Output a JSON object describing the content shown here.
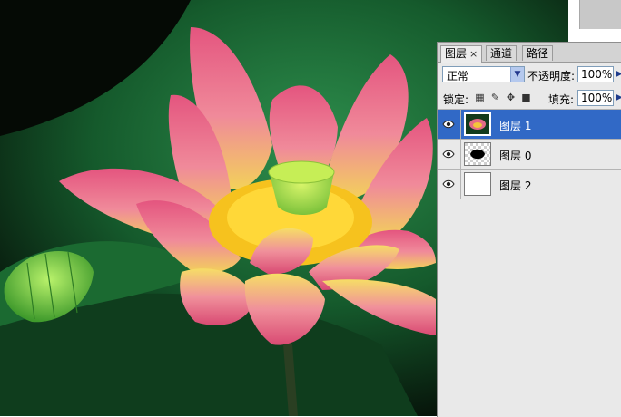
{
  "tabs": [
    {
      "label": "图层",
      "close": "×",
      "active": true
    },
    {
      "label": "通道",
      "active": false
    },
    {
      "label": "路径",
      "active": false
    }
  ],
  "blend_mode": {
    "value": "正常"
  },
  "opacity": {
    "label": "不透明度:",
    "value": "100%"
  },
  "lock": {
    "label": "锁定:"
  },
  "fill": {
    "label": "填充:",
    "value": "100%"
  },
  "layers": [
    {
      "name": "图层 1",
      "selected": true,
      "visible": true,
      "thumb": "lotus-photo"
    },
    {
      "name": "图层 0",
      "selected": false,
      "visible": true,
      "thumb": "mask-shape"
    },
    {
      "name": "图层 2",
      "selected": false,
      "visible": true,
      "thumb": "blank-white"
    }
  ],
  "icons": {
    "eye": "eye-icon",
    "dropdown": "chevron-down-icon",
    "flyout": "triangle-right-icon",
    "lock_transparency": "checker-icon",
    "lock_paint": "brush-icon",
    "lock_move": "move-icon",
    "lock_all": "lock-icon"
  },
  "colors": {
    "selection": "#3169c6",
    "panel_bg": "#e9e9e9",
    "petal_pink": "#e0577f",
    "leaf_green": "#1f7a3a"
  }
}
